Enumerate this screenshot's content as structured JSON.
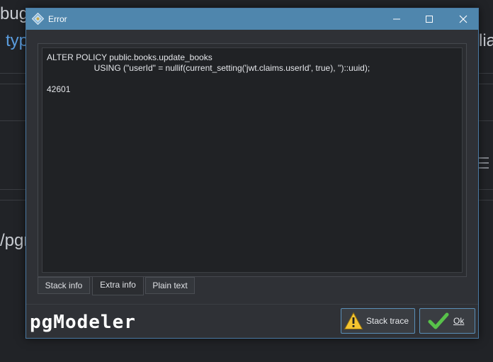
{
  "background": {
    "line1": "bug",
    "line2": "typ",
    "line3": "/pgr",
    "line4_right": "lia"
  },
  "dialog": {
    "title": "Error",
    "message": "ALTER POLICY public.books.update_books\n                    USING (\"userId\" = nullif(current_setting('jwt.claims.userId', true), '')::uuid);\n\n42601",
    "tabs": [
      "Stack info",
      "Extra info",
      "Plain text"
    ],
    "active_tab": "Extra info",
    "brand": "pgModeler",
    "buttons": {
      "stack_trace": "Stack trace",
      "ok": "Ok"
    }
  },
  "colors": {
    "titlebar": "#4f86ad",
    "accent_border": "#5a8fb8",
    "warning": "#f4c430"
  },
  "icons": {
    "title": "pgmodeler-diamond-icon",
    "minimize": "minimize-icon",
    "maximize": "maximize-icon",
    "close": "close-icon",
    "stack_trace": "warning-icon",
    "ok": "checkmark-icon"
  }
}
